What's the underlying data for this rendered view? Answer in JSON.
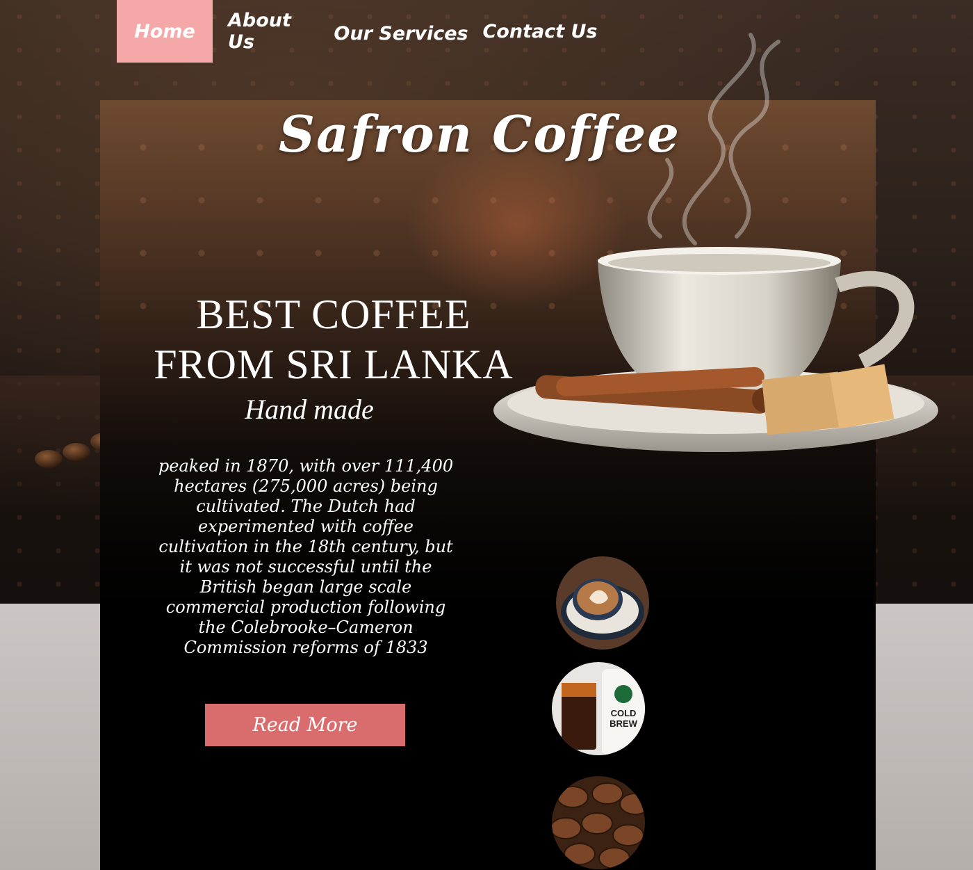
{
  "nav": {
    "items": [
      {
        "label": "Home",
        "active": true
      },
      {
        "label": "About Us",
        "active": false
      },
      {
        "label": "Our Services",
        "active": false
      },
      {
        "label": "Contact Us",
        "active": false
      }
    ]
  },
  "brand": {
    "title": "Safron Coffee"
  },
  "hero": {
    "headline_line1": "BEST COFFEE",
    "headline_line2": "FROM SRI LANKA",
    "subheading": "Hand made",
    "body": "peaked in 1870, with over 111,400 hectares (275,000 acres) being cultivated. The Dutch had experimented with coffee cultivation in the 18th century, but it was not successful until the British began large scale commercial production following the Colebrooke–Cameron Commission reforms of 1833",
    "button_label": "Read More"
  },
  "thumbnails": [
    {
      "name": "latte-art-cup",
      "icon": "latte-icon"
    },
    {
      "name": "cold-brew",
      "label": "COLD BREW",
      "icon": "cold-brew-icon"
    },
    {
      "name": "coffee-beans",
      "icon": "beans-icon"
    }
  ],
  "colors": {
    "active_nav": "#f4a8a8",
    "button": "#d96d6d",
    "text": "#ffffff"
  }
}
